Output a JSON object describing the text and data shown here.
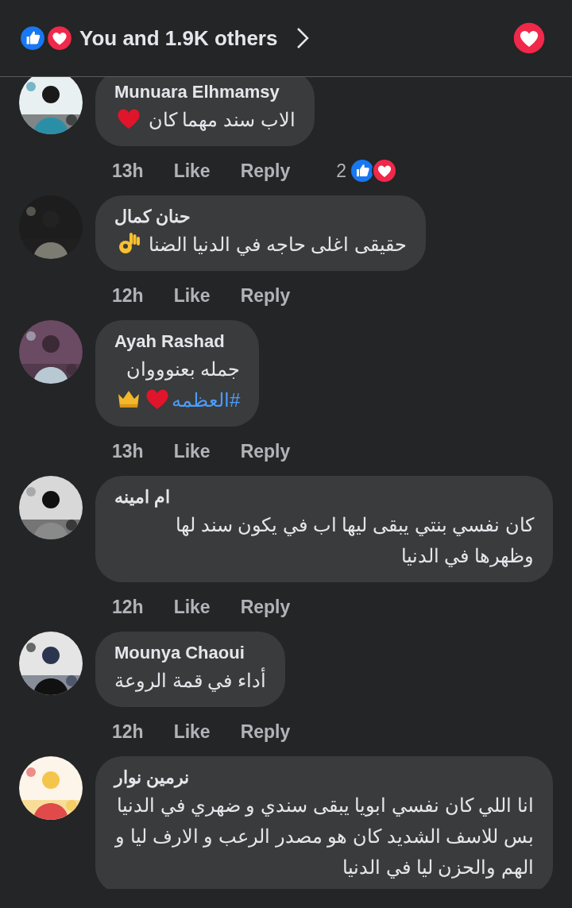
{
  "header": {
    "reactions": [
      {
        "kind": "like"
      },
      {
        "kind": "love"
      }
    ],
    "summary": "You and 1.9K others",
    "my_reaction": {
      "kind": "love"
    }
  },
  "comments": [
    {
      "author": "Munuara Elhmamsy",
      "text": "الاب سند مهما كان",
      "emojis": [
        {
          "kind": "heart"
        }
      ],
      "time": "13h",
      "like": "Like",
      "reply": "Reply",
      "reaction_count": "2",
      "reactions": [
        {
          "kind": "like"
        },
        {
          "kind": "love"
        }
      ]
    },
    {
      "author": "حنان كمال",
      "text": "حقيقى  اغلى حاجه في الدنيا الضنا",
      "emojis": [
        {
          "kind": "ok"
        }
      ],
      "time": "12h",
      "like": "Like",
      "reply": "Reply"
    },
    {
      "author": "Ayah Rashad",
      "text": "جمله بعنوووان",
      "hashtag": "#العظمه",
      "emojis": [
        {
          "kind": "heart"
        },
        {
          "kind": "crown"
        }
      ],
      "time": "13h",
      "like": "Like",
      "reply": "Reply"
    },
    {
      "author": "ام امينه",
      "text": "كان نفسي بنتي يبقى ليها اب في يكون سند لها وظهرها في الدنيا",
      "time": "12h",
      "like": "Like",
      "reply": "Reply"
    },
    {
      "author": "Mounya Chaoui",
      "text": "أداء في قمة الروعة",
      "time": "12h",
      "like": "Like",
      "reply": "Reply"
    },
    {
      "author": "نرمين نوار",
      "text": "انا اللي كان نفسي ابويا يبقى سندي و ضهري في الدنيا بس للاسف الشديد كان هو مصدر الرعب و الارف ليا و الهم والحزن ليا في الدنيا"
    }
  ]
}
